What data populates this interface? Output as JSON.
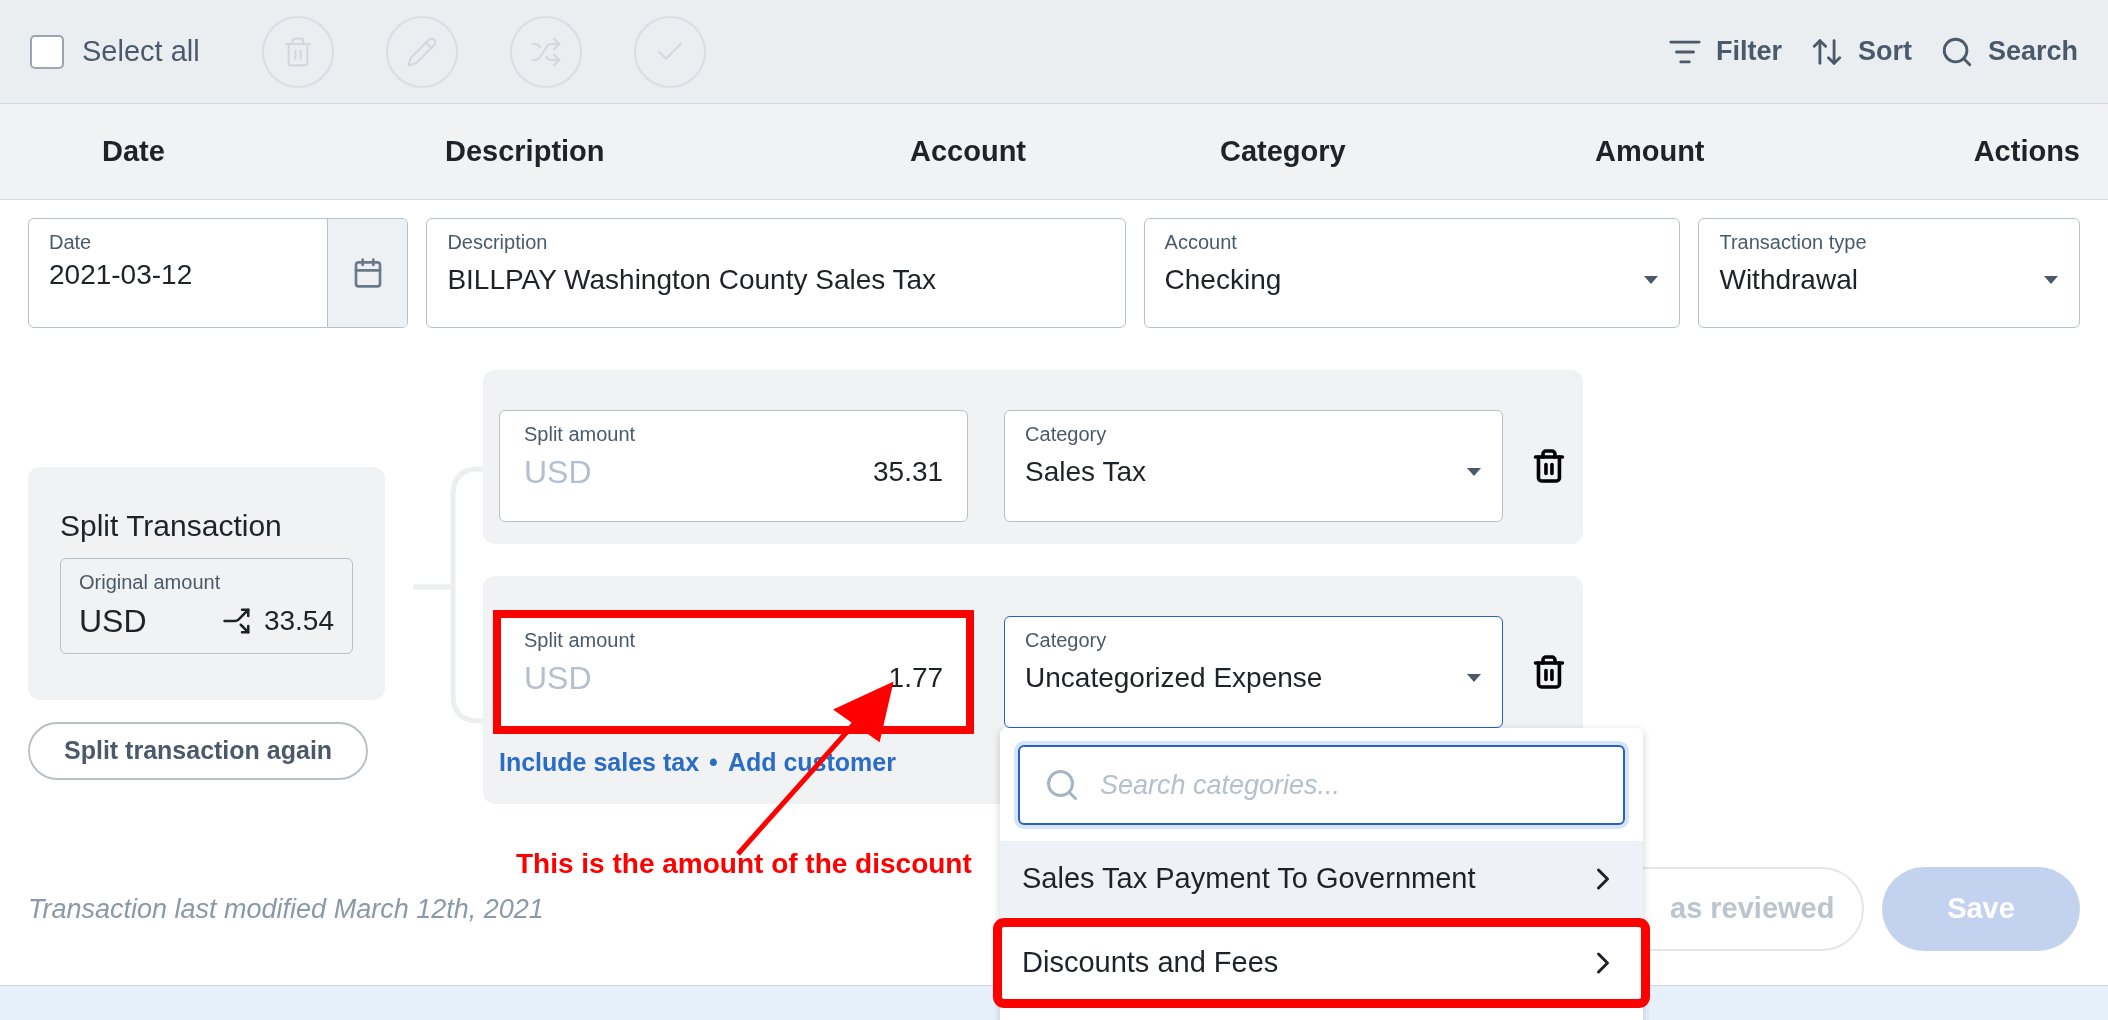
{
  "toolbar": {
    "select_all": {
      "label": "Select all",
      "checked": false
    },
    "icon_buttons": [
      {
        "kind": "delete",
        "disabled": true
      },
      {
        "kind": "edit",
        "disabled": true
      },
      {
        "kind": "split",
        "disabled": true
      },
      {
        "kind": "review",
        "disabled": true
      }
    ],
    "actions": [
      {
        "kind": "filter",
        "label": "Filter"
      },
      {
        "kind": "sort",
        "label": "Sort"
      },
      {
        "kind": "search",
        "label": "Search"
      }
    ]
  },
  "table": {
    "columns": [
      "Date",
      "Description",
      "Account",
      "Category",
      "Amount",
      "Actions"
    ]
  },
  "form": {
    "date": {
      "label": "Date",
      "value": "2021-03-12"
    },
    "description": {
      "label": "Description",
      "value": "BILLPAY Washington County Sales Tax"
    },
    "account": {
      "label": "Account",
      "value": "Checking"
    },
    "transaction_type": {
      "label": "Transaction type",
      "value": "Withdrawal"
    }
  },
  "split": {
    "title": "Split Transaction",
    "original": {
      "label": "Original amount",
      "currency": "USD",
      "value": "33.54"
    },
    "again_button": "Split transaction again",
    "rows": [
      {
        "amount_label": "Split amount",
        "currency": "USD",
        "amount": "35.31",
        "category_label": "Category",
        "category": "Sales Tax",
        "focused": false,
        "highlighted": false
      },
      {
        "amount_label": "Split amount",
        "currency": "USD",
        "amount": "1.77",
        "category_label": "Category",
        "category": "Uncategorized Expense",
        "focused": true,
        "highlighted": true,
        "links": [
          "Include sales tax",
          "Add customer"
        ],
        "separator": "•"
      }
    ]
  },
  "dropdown": {
    "placeholder": "Search categories...",
    "items": [
      {
        "label": "Sales Tax Payment To Government",
        "selected": true,
        "highlighted": false
      },
      {
        "label": "Discounts and Fees",
        "selected": false,
        "highlighted": true
      }
    ]
  },
  "footer": {
    "modified": "Transaction last modified March 12th, 2021",
    "buttons": [
      {
        "kind": "outline",
        "label": "as reviewed",
        "disabled": true
      },
      {
        "kind": "primary",
        "label": "Save",
        "disabled": true
      }
    ]
  },
  "annotation": {
    "text": "This is the amount of the discount"
  }
}
